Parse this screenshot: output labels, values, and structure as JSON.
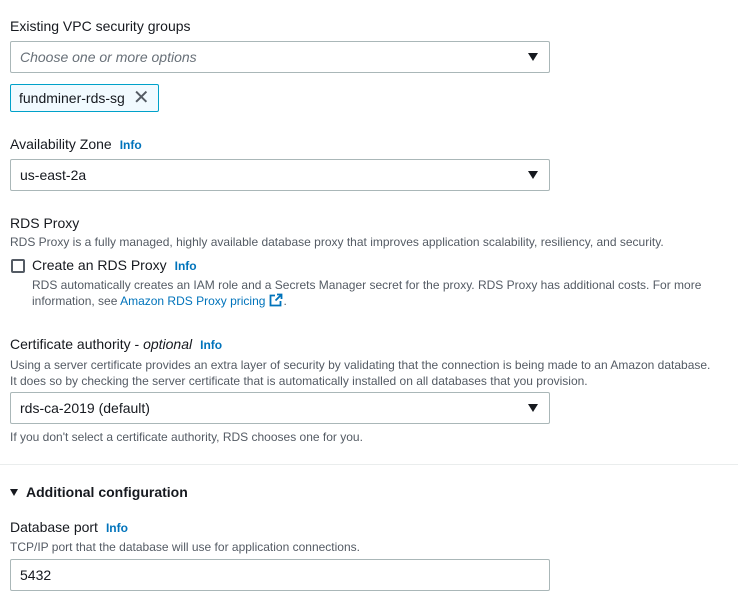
{
  "vpc_security_groups": {
    "label": "Existing VPC security groups",
    "placeholder": "Choose one or more options",
    "selected_token": "fundminer-rds-sg",
    "remove_glyph": "✕"
  },
  "availability_zone": {
    "label": "Availability Zone",
    "info": "Info",
    "value": "us-east-2a"
  },
  "rds_proxy": {
    "heading": "RDS Proxy",
    "description": "RDS Proxy is a fully managed, highly available database proxy that improves application scalability, resiliency, and security.",
    "checkbox_label": "Create an RDS Proxy",
    "checked": false,
    "info": "Info",
    "help_line1": "RDS automatically creates an IAM role and a Secrets Manager secret for the proxy. RDS Proxy has additional costs. For more",
    "help_line2_prefix": "information, see ",
    "pricing_link": "Amazon RDS Proxy pricing",
    "help_line2_suffix": "."
  },
  "certificate_authority": {
    "label": "Certificate authority - ",
    "label_optional": "optional",
    "info": "Info",
    "description_line1": "Using a server certificate provides an extra layer of security by validating that the connection is being made to an Amazon database.",
    "description_line2": "It does so by checking the server certificate that is automatically installed on all databases that you provision.",
    "value": "rds-ca-2019 (default)",
    "hint": "If you don't select a certificate authority, RDS chooses one for you."
  },
  "additional_configuration": {
    "title": "Additional configuration",
    "expanded": true
  },
  "database_port": {
    "label": "Database port",
    "info": "Info",
    "description": "TCP/IP port that the database will use for application connections.",
    "value": "5432"
  },
  "colors": {
    "link": "#0073bb",
    "text": "#16191f",
    "muted": "#545b64",
    "border": "#aab7b8",
    "token_border": "#00a1c9",
    "token_bg": "#f1faff"
  }
}
